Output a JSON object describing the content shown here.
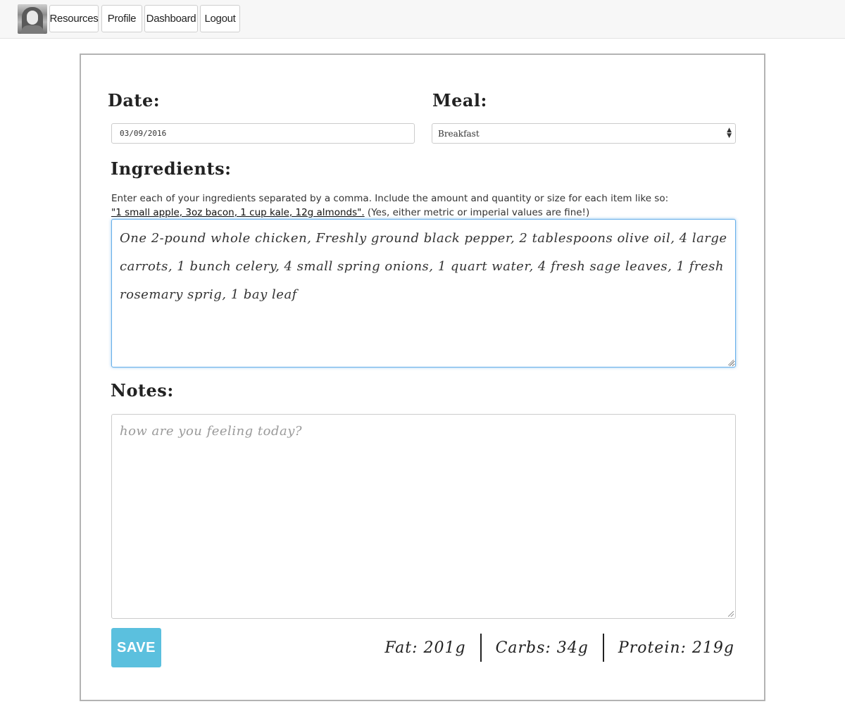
{
  "nav": {
    "items": [
      {
        "label": "Resources"
      },
      {
        "label": "Profile"
      },
      {
        "label": "Dashboard"
      },
      {
        "label": "Logout"
      }
    ]
  },
  "form": {
    "date_label": "Date:",
    "date_value": "03/09/2016",
    "meal_label": "Meal:",
    "meal_selected": "Breakfast",
    "ingredients_label": "Ingredients:",
    "help_text_intro": "Enter each of your ingredients separated by a comma. Include the amount and quantity or size for each item like so:",
    "help_text_example": "\"1 small apple, 3oz bacon, 1 cup kale, 12g almonds\".",
    "help_text_note": "(Yes, either metric or imperial values are fine!)",
    "ingredients_value": "One 2-pound whole chicken, Freshly ground black pepper, 2 tablespoons olive oil, 4 large carrots, 1 bunch celery, 4 small spring onions, 1 quart water, 4 fresh sage leaves, 1 fresh rosemary sprig, 1 bay leaf",
    "notes_label": "Notes:",
    "notes_placeholder": "how are you feeling today?",
    "save_label": "SAVE"
  },
  "macros": {
    "fat": "Fat: 201g",
    "carbs": "Carbs: 34g",
    "protein": "Protein: 219g"
  },
  "colors": {
    "save_button": "#5bc0de",
    "focus_border": "#66afe9"
  }
}
